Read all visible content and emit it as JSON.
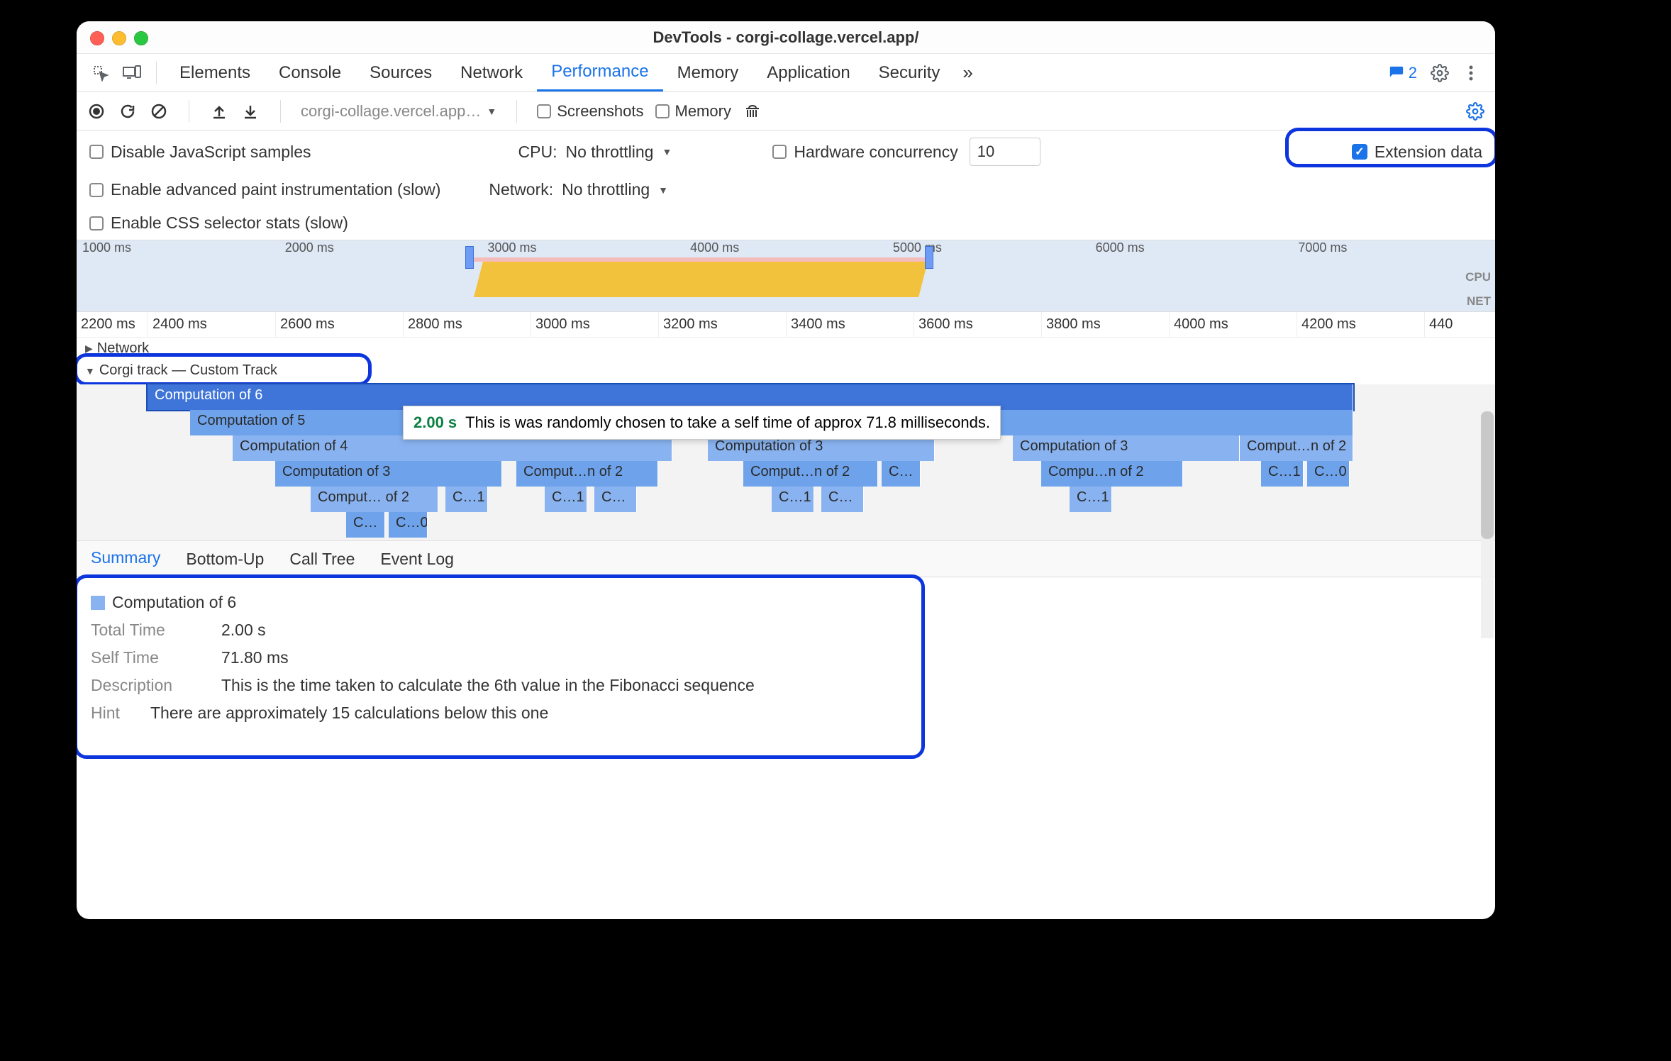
{
  "window": {
    "title": "DevTools - corgi-collage.vercel.app/"
  },
  "tabs": {
    "items": [
      "Elements",
      "Console",
      "Sources",
      "Network",
      "Performance",
      "Memory",
      "Application",
      "Security"
    ],
    "active": "Performance",
    "overflow": "»",
    "issues_count": "2"
  },
  "actions": {
    "recording_target": "corgi-collage.vercel.app…",
    "screenshots_label": "Screenshots",
    "memory_label": "Memory"
  },
  "settings": {
    "disable_js": "Disable JavaScript samples",
    "cpu_label": "CPU:",
    "cpu_value": "No throttling",
    "hw_label": "Hardware concurrency",
    "hw_value": "10",
    "ext_label": "Extension data",
    "adv_paint": "Enable advanced paint instrumentation (slow)",
    "net_label": "Network:",
    "net_value": "No throttling",
    "css_stats": "Enable CSS selector stats (slow)"
  },
  "overview": {
    "ticks": [
      "1000 ms",
      "2000 ms",
      "3000 ms",
      "4000 ms",
      "5000 ms",
      "6000 ms",
      "7000 ms"
    ],
    "cpu_label": "CPU",
    "net_label": "NET"
  },
  "ruler": [
    "2200 ms",
    "2400 ms",
    "2600 ms",
    "2800 ms",
    "3000 ms",
    "3200 ms",
    "3400 ms",
    "3600 ms",
    "3800 ms",
    "4000 ms",
    "4200 ms",
    "440"
  ],
  "tracks": {
    "network": "Network",
    "custom": "Corgi track — Custom Track"
  },
  "tooltip": {
    "time": "2.00 s",
    "msg": "This is was randomly chosen to take a self time of approx 71.8 milliseconds."
  },
  "flames": {
    "r0": "Computation of 6",
    "r1": "Computation of 5",
    "r2a": "Computation of 4",
    "r2b": "Computation of 3",
    "r2c": "Computation of 3",
    "r2d": "Comput…n of 2",
    "r3a": "Computation of 3",
    "r3b": "Comput…n of 2",
    "r3c": "Comput…n of 2",
    "r3d": "C…",
    "r3e": "Compu…n of 2",
    "r3f": "C…1",
    "r3g": "C…0",
    "r4a": "Comput… of 2",
    "r4b": "C…1",
    "r4c": "C…1",
    "r4d": "C…",
    "r4e": "C…1",
    "r4f": "C…",
    "r4g": "C…1",
    "r5a": "C…",
    "r5b": "C…0"
  },
  "btabs": {
    "items": [
      "Summary",
      "Bottom-Up",
      "Call Tree",
      "Event Log"
    ],
    "active": "Summary"
  },
  "summary": {
    "title": "Computation of 6",
    "total_k": "Total Time",
    "total_v": "2.00 s",
    "self_k": "Self Time",
    "self_v": "71.80 ms",
    "desc_k": "Description",
    "desc_v": "This is the time taken to calculate the 6th value in the Fibonacci sequence",
    "hint_k": "Hint",
    "hint_v": "There are approximately 15 calculations below this one"
  }
}
